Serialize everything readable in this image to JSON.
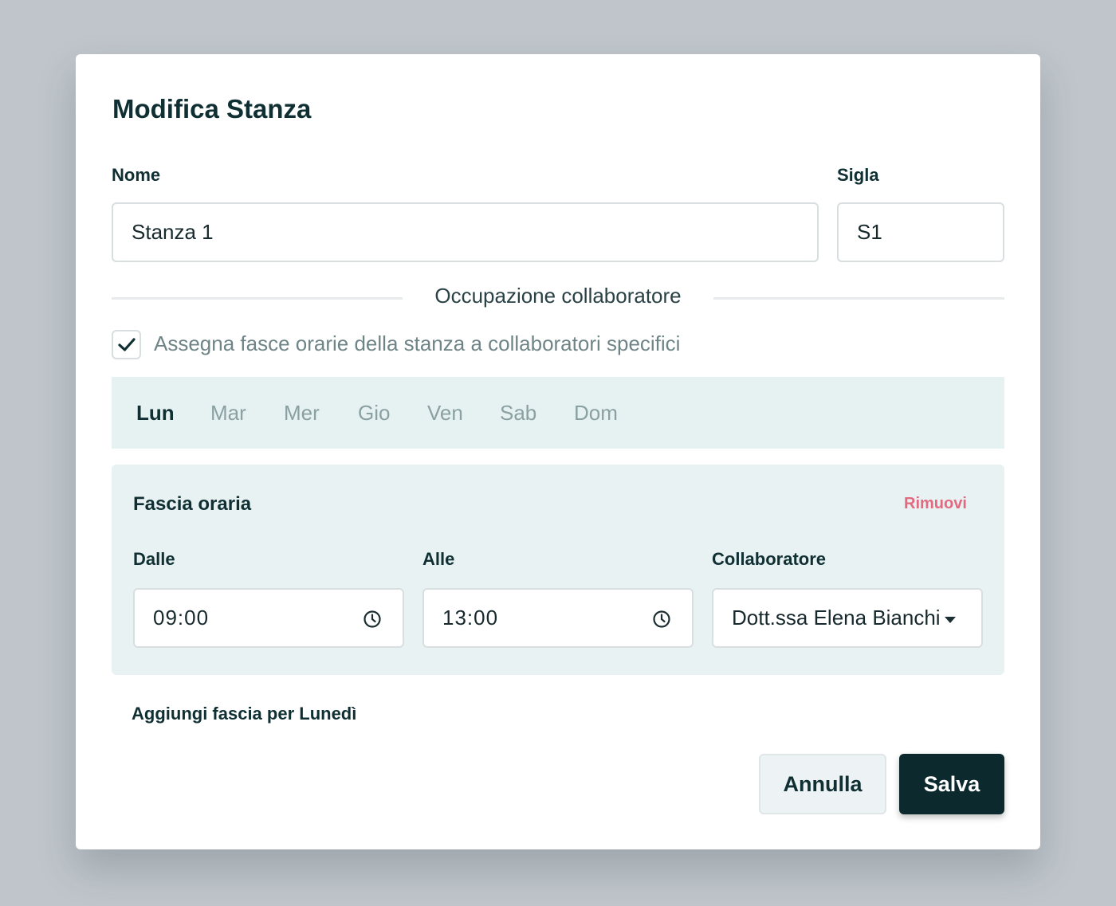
{
  "modal": {
    "title": "Modifica Stanza",
    "fields": {
      "nome_label": "Nome",
      "nome_value": "Stanza 1",
      "sigla_label": "Sigla",
      "sigla_value": "S1"
    },
    "section_title": "Occupazione collaboratore",
    "assign_checkbox": {
      "label": "Assegna fasce orarie della stanza a collaboratori specifici",
      "checked": true
    },
    "day_tabs": [
      {
        "label": "Lun",
        "active": true
      },
      {
        "label": "Mar",
        "active": false
      },
      {
        "label": "Mer",
        "active": false
      },
      {
        "label": "Gio",
        "active": false
      },
      {
        "label": "Ven",
        "active": false
      },
      {
        "label": "Sab",
        "active": false
      },
      {
        "label": "Dom",
        "active": false
      }
    ],
    "time_slot": {
      "title": "Fascia oraria",
      "remove_label": "Rimuovi",
      "from_label": "Dalle",
      "from_value": "09:00",
      "to_label": "Alle",
      "to_value": "13:00",
      "collaborator_label": "Collaboratore",
      "collaborator_value": "Dott.ssa Elena Bianchi"
    },
    "add_slot_label": "Aggiungi fascia per Lunedì",
    "buttons": {
      "cancel": "Annulla",
      "save": "Salva"
    }
  },
  "colors": {
    "background": "#bfc5cb",
    "primary": "#0c2a2e",
    "danger": "#e26a80",
    "panel": "#e9f2f3"
  },
  "icons": [
    "check-icon",
    "clock-icon",
    "chevron-down-icon"
  ]
}
